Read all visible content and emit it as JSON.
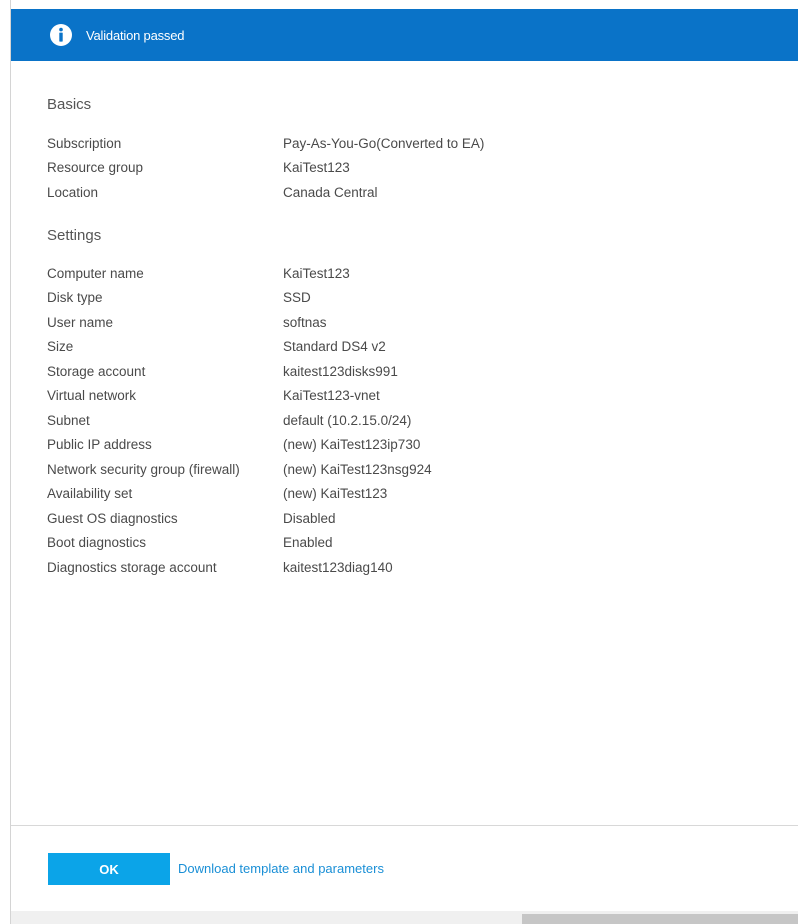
{
  "banner": {
    "icon": "info-icon",
    "text": "Validation passed",
    "color": "#0a73c8"
  },
  "basics": {
    "title": "Basics",
    "rows": [
      {
        "label": "Subscription",
        "value": "Pay-As-You-Go(Converted to EA)"
      },
      {
        "label": "Resource group",
        "value": "KaiTest123"
      },
      {
        "label": "Location",
        "value": "Canada Central"
      }
    ]
  },
  "settings": {
    "title": "Settings",
    "rows": [
      {
        "label": "Computer name",
        "value": "KaiTest123"
      },
      {
        "label": "Disk type",
        "value": "SSD"
      },
      {
        "label": "User name",
        "value": "softnas"
      },
      {
        "label": "Size",
        "value": "Standard DS4 v2"
      },
      {
        "label": "Storage account",
        "value": "kaitest123disks991"
      },
      {
        "label": "Virtual network",
        "value": "KaiTest123-vnet"
      },
      {
        "label": "Subnet",
        "value": "default (10.2.15.0/24)"
      },
      {
        "label": "Public IP address",
        "value": "(new) KaiTest123ip730"
      },
      {
        "label": "Network security group (firewall)",
        "value": "(new) KaiTest123nsg924"
      },
      {
        "label": "Availability set",
        "value": "(new) KaiTest123"
      },
      {
        "label": "Guest OS diagnostics",
        "value": "Disabled"
      },
      {
        "label": "Boot diagnostics",
        "value": "Enabled"
      },
      {
        "label": "Diagnostics storage account",
        "value": "kaitest123diag140"
      }
    ]
  },
  "footer": {
    "ok_label": "OK",
    "download_label": "Download template and parameters",
    "button_color": "#0ba4e8",
    "link_color": "#1a8fd6"
  }
}
